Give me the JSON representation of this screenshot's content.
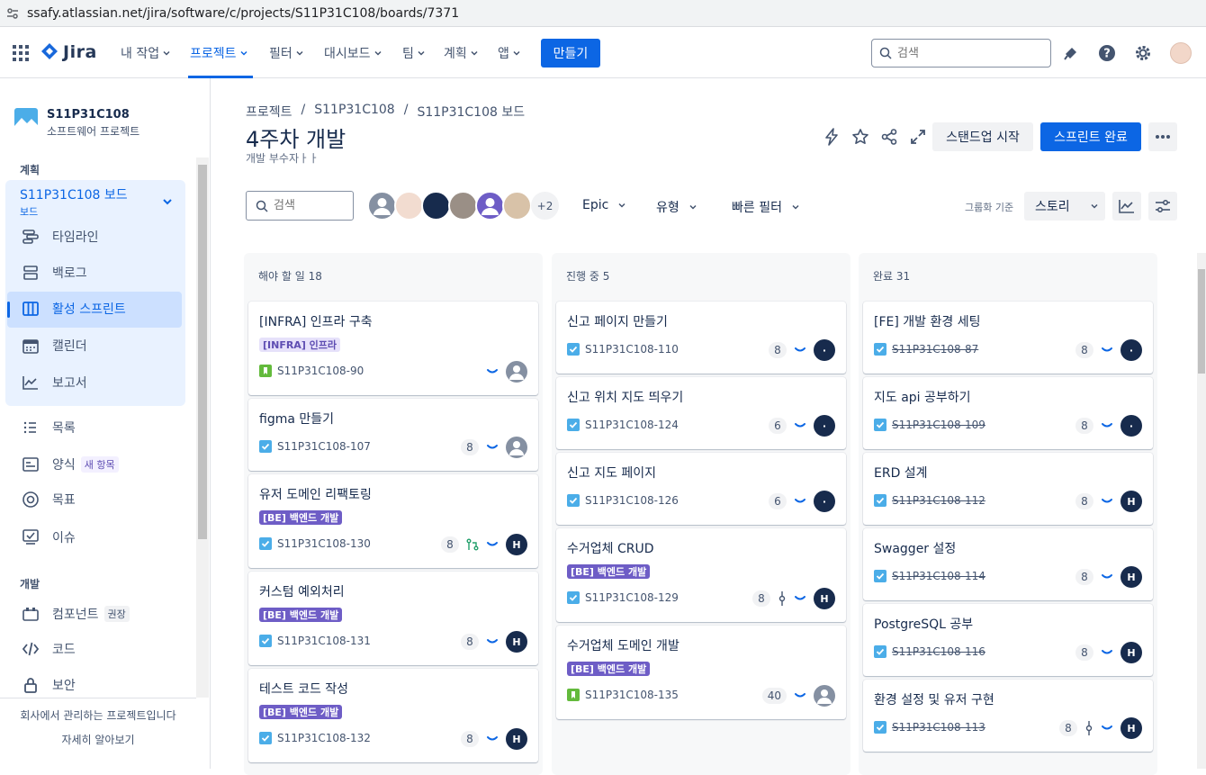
{
  "browser": {
    "url": "ssafy.atlassian.net/jira/software/c/projects/S11P31C108/boards/7371"
  },
  "topnav": {
    "logo": "Jira",
    "items": [
      {
        "label": "내 작업"
      },
      {
        "label": "프로젝트"
      },
      {
        "label": "필터"
      },
      {
        "label": "대시보드"
      },
      {
        "label": "팀"
      },
      {
        "label": "계획"
      },
      {
        "label": "앱"
      }
    ],
    "create_label": "만들기",
    "search_placeholder": "검색",
    "icons": [
      "waffle-icon",
      "notification-icon",
      "help-icon",
      "settings-icon"
    ]
  },
  "sidebar": {
    "project_name": "S11P31C108",
    "project_type": "소프트웨어 프로젝트",
    "section_plan": "계획",
    "board_name": "S11P31C108 보드",
    "board_sub": "보드",
    "plan_items": [
      {
        "label": "타임라인"
      },
      {
        "label": "백로그"
      },
      {
        "label": "활성 스프린트"
      },
      {
        "label": "캘린더"
      },
      {
        "label": "보고서"
      }
    ],
    "other_items": [
      {
        "label": "목록"
      },
      {
        "label": "양식",
        "badge": "새 항목"
      },
      {
        "label": "목표"
      },
      {
        "label": "이슈"
      }
    ],
    "section_dev": "개발",
    "dev_items": [
      {
        "label": "컴포넌트",
        "badge": "권장"
      },
      {
        "label": "코드"
      },
      {
        "label": "보안"
      }
    ],
    "footer_text": "회사에서 관리하는 프로젝트입니다",
    "footer_link": "자세히 알아보기"
  },
  "header": {
    "breadcrumbs": [
      "프로젝트",
      "/",
      "S11P31C108",
      "/",
      "S11P31C108 보드"
    ],
    "title": "4주차 개발",
    "subtitle": "개발 부수자ㅏㅏ",
    "standup_label": "스탠드업 시작",
    "complete_label": "스프린트 완료"
  },
  "filters": {
    "search_placeholder": "검색",
    "more_count": "+2",
    "epic_label": "Epic",
    "type_label": "유형",
    "quick_label": "빠른 필터",
    "group_label": "그룹화 기준",
    "group_value": "스토리"
  },
  "columns": [
    {
      "title": "해야 할 일 18",
      "cards": [
        {
          "title": "[INFRA] 인프라 구축",
          "label": "[INFRA] 인프라",
          "label_style": "infra",
          "type": "story",
          "key": "S11P31C108-90",
          "points": "",
          "avatar": "gray",
          "done": false
        },
        {
          "title": "figma 만들기",
          "label": "",
          "type": "task",
          "key": "S11P31C108-107",
          "points": "8",
          "avatar": "gray",
          "done": false
        },
        {
          "title": "유저 도메인 리팩토링",
          "label": "[BE] 백엔드 개발",
          "label_style": "be",
          "type": "task",
          "key": "S11P31C108-130",
          "points": "8",
          "pr": true,
          "avatar": "H",
          "done": false
        },
        {
          "title": "커스텀 예외처리",
          "label": "[BE] 백엔드 개발",
          "label_style": "be",
          "type": "task",
          "key": "S11P31C108-131",
          "points": "8",
          "avatar": "H",
          "done": false
        },
        {
          "title": "테스트 코드 작성",
          "label": "[BE] 백엔드 개발",
          "label_style": "be",
          "type": "task",
          "key": "S11P31C108-132",
          "points": "8",
          "avatar": "H",
          "done": false
        }
      ]
    },
    {
      "title": "진행 중 5",
      "cards": [
        {
          "title": "신고 페이지 만들기",
          "label": "",
          "type": "task",
          "key": "S11P31C108-110",
          "points": "8",
          "avatar": "·",
          "done": false
        },
        {
          "title": "신고 위치 지도 띄우기",
          "label": "",
          "type": "task",
          "key": "S11P31C108-124",
          "points": "6",
          "avatar": "·",
          "done": false
        },
        {
          "title": "신고 지도 페이지",
          "label": "",
          "type": "task",
          "key": "S11P31C108-126",
          "points": "6",
          "avatar": "·",
          "done": false
        },
        {
          "title": "수거업체 CRUD",
          "label": "[BE] 백엔드 개발",
          "label_style": "be",
          "type": "task",
          "key": "S11P31C108-129",
          "points": "8",
          "commit": true,
          "avatar": "H",
          "done": false
        },
        {
          "title": "수거업체 도메인 개발",
          "label": "[BE] 백엔드 개발",
          "label_style": "be",
          "type": "story",
          "key": "S11P31C108-135",
          "points": "40",
          "avatar": "gray",
          "done": false
        }
      ]
    },
    {
      "title": "완료 31",
      "cards": [
        {
          "title": "[FE] 개발 환경 세팅",
          "label": "",
          "type": "task",
          "key": "S11P31C108-87",
          "points": "8",
          "avatar": "·",
          "done": true
        },
        {
          "title": "지도 api 공부하기",
          "label": "",
          "type": "task",
          "key": "S11P31C108-109",
          "points": "8",
          "avatar": "·",
          "done": true
        },
        {
          "title": "ERD 설계",
          "label": "",
          "type": "task",
          "key": "S11P31C108-112",
          "points": "8",
          "avatar": "H",
          "done": true
        },
        {
          "title": "Swagger 설정",
          "label": "",
          "type": "task",
          "key": "S11P31C108-114",
          "points": "8",
          "avatar": "H",
          "done": true
        },
        {
          "title": "PostgreSQL 공부",
          "label": "",
          "type": "task",
          "key": "S11P31C108-116",
          "points": "8",
          "avatar": "H",
          "done": true
        },
        {
          "title": "환경 설정 및 유저 구현",
          "label": "",
          "type": "task",
          "key": "S11P31C108-113",
          "points": "8",
          "commit": true,
          "avatar": "H",
          "done": true
        }
      ]
    }
  ],
  "colors": {
    "brand": "#0c66e4",
    "dark_avatar": "#172b4d",
    "be_label": "#6e5dc6",
    "task": "#4bade8",
    "story": "#63ba3c"
  }
}
